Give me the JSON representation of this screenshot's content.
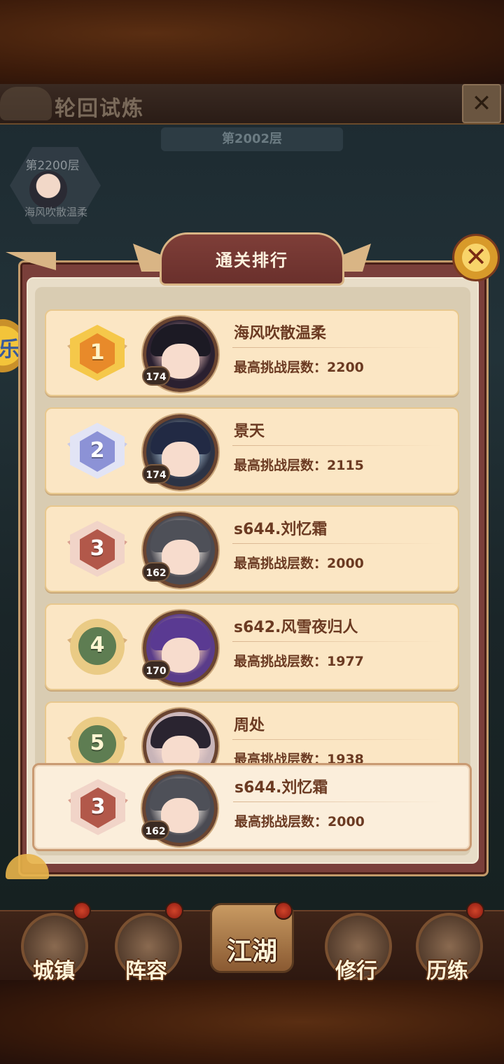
{
  "page": {
    "title": "轮回试炼"
  },
  "floor_banner": "第2002层",
  "top_player": {
    "floor": "第2200层",
    "name": "海风吹散温柔"
  },
  "side_badge": "乐",
  "dialog": {
    "title": "通关排行"
  },
  "leaderboard": [
    {
      "rank": "1",
      "name": "海风吹散温柔",
      "level": "174",
      "stat_label": "最高挑战层数：",
      "value": "2200"
    },
    {
      "rank": "2",
      "name": "景天",
      "level": "174",
      "stat_label": "最高挑战层数：",
      "value": "2115"
    },
    {
      "rank": "3",
      "name": "s644.刘忆霜",
      "level": "162",
      "stat_label": "最高挑战层数：",
      "value": "2000"
    },
    {
      "rank": "4",
      "name": "s642.风雪夜归人",
      "level": "170",
      "stat_label": "最高挑战层数：",
      "value": "1977"
    },
    {
      "rank": "5",
      "name": "周处",
      "level": "",
      "stat_label": "最高挑战层数：",
      "value": "1938"
    }
  ],
  "self": {
    "rank": "3",
    "name": "s644.刘忆霜",
    "level": "162",
    "stat_label": "最高挑战层数：",
    "value": "2000"
  },
  "nav": [
    "城镇",
    "阵容",
    "江湖",
    "修行",
    "历练"
  ],
  "icons": {
    "close": "close-icon",
    "medal": "medal-icon",
    "avatar": "avatar-icon"
  }
}
